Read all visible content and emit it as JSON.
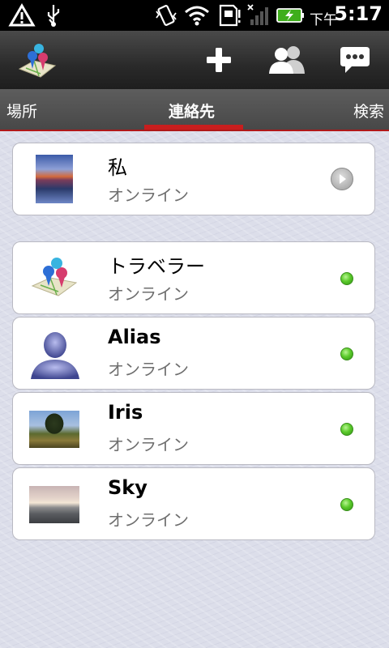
{
  "statusbar": {
    "ampm": "下午",
    "time": "5:17"
  },
  "actionbar": {
    "app_icon": "map-pins-app-icon",
    "add_icon": "plus-icon",
    "contacts_icon": "people-icon",
    "chat_icon": "chat-bubble-icon"
  },
  "tabs": [
    {
      "label": "場所",
      "active": false
    },
    {
      "label": "連絡先",
      "active": true
    },
    {
      "label": "検索",
      "active": false
    }
  ],
  "me": {
    "name": "私",
    "status": "オンライン"
  },
  "contacts": [
    {
      "name": "トラベラー",
      "status": "オンライン",
      "online": true
    },
    {
      "name": "Alias",
      "status": "オンライン",
      "online": true
    },
    {
      "name": "Iris",
      "status": "オンライン",
      "online": true
    },
    {
      "name": "Sky",
      "status": "オンライン",
      "online": true
    }
  ],
  "colors": {
    "accent": "#c81e1e",
    "online": "#5ccb2c"
  }
}
